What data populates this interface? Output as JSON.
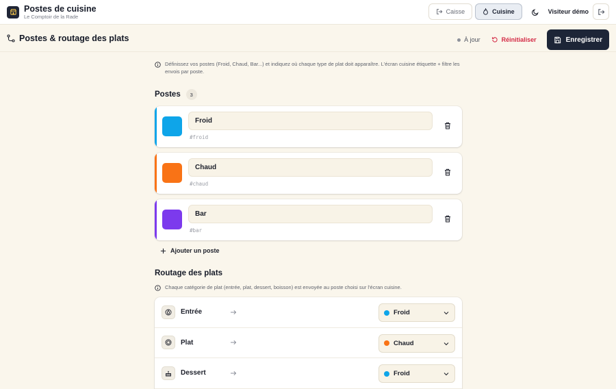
{
  "app": {
    "title": "Postes de cuisine",
    "subtitle": "Le Comptoir de la Rade"
  },
  "topbar": {
    "modes": [
      {
        "label": "Caisse",
        "active": false,
        "icon": "pos-exit-icon"
      },
      {
        "label": "Cuisine",
        "active": true,
        "icon": "flame-icon"
      }
    ],
    "theme_icon": "moon-icon",
    "user": "Visiteur démo",
    "logout_icon": "logout-icon"
  },
  "page": {
    "title": "Postes & routage des plats",
    "status": "À jour",
    "reset_label": "Réinitialiser",
    "save_label": "Enregistrer"
  },
  "stations_section": {
    "info": "Définissez vos postes (Froid, Chaud, Bar...) et indiquez où chaque type de plat doit apparaître. L'écran cuisine étiquette + filtre les envois par poste.",
    "title": "Postes",
    "count": "3",
    "stations": [
      {
        "name": "Froid",
        "slug": "#froid",
        "color": "#0ea5e9"
      },
      {
        "name": "Chaud",
        "slug": "#chaud",
        "color": "#f97316"
      },
      {
        "name": "Bar",
        "slug": "#bar",
        "color": "#7c3aed"
      }
    ],
    "add_label": "Ajouter un poste"
  },
  "routing_section": {
    "title": "Routage des plats",
    "info": "Chaque catégorie de plat (entrée, plat, dessert, boisson) est envoyée au poste choisi sur l'écran cuisine.",
    "rows": [
      {
        "label": "Entrée",
        "icon": "drop-icon",
        "station": "Froid",
        "color": "#0ea5e9"
      },
      {
        "label": "Plat",
        "icon": "plate-icon",
        "station": "Chaud",
        "color": "#f97316"
      },
      {
        "label": "Dessert",
        "icon": "cake-icon",
        "station": "Froid",
        "color": "#0ea5e9"
      }
    ]
  },
  "colors": {
    "accent_dark": "#1d2537",
    "danger": "#d42a45",
    "background": "#faf6ec"
  }
}
